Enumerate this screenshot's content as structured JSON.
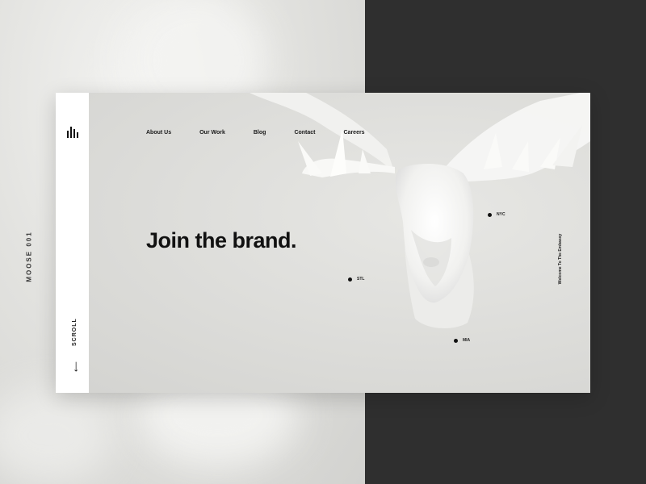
{
  "page": {
    "side_label": "MOOSE 001"
  },
  "brand": {
    "logo_icon": "bars-logo-icon"
  },
  "nav": {
    "items": [
      {
        "label": "About Us"
      },
      {
        "label": "Our Work"
      },
      {
        "label": "Blog"
      },
      {
        "label": "Contact"
      },
      {
        "label": "Careers"
      }
    ]
  },
  "hero": {
    "headline": "Join the brand.",
    "tagline": "Welcome To The Embassy"
  },
  "markers": [
    {
      "label": "NYC"
    },
    {
      "label": "STL"
    },
    {
      "label": "MIA"
    }
  ],
  "scroll": {
    "label": "SCROLL",
    "icon": "arrow-left-icon"
  },
  "colors": {
    "dark_panel": "#2f2f2f",
    "card": "#dcdcd9",
    "sidebar": "#ffffff",
    "text": "#111111"
  }
}
